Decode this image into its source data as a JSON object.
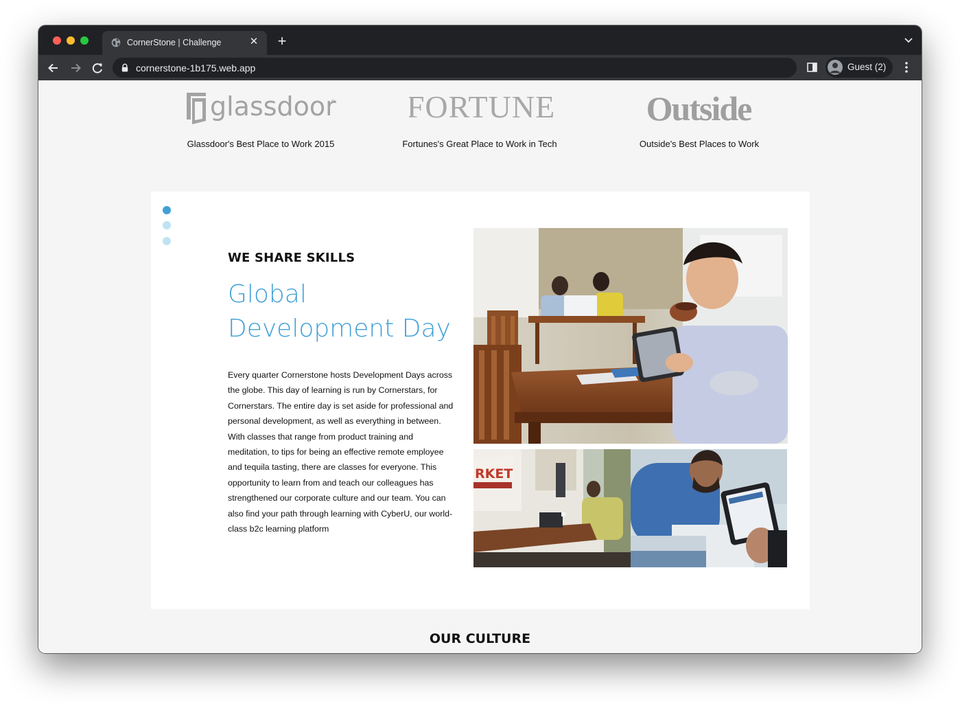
{
  "browser": {
    "tab_title": "CornerStone | Challenge",
    "url": "cornerstone-1b175.web.app",
    "profile_label": "Guest (2)"
  },
  "awards": [
    {
      "logo_text": "glassdoor",
      "caption": "Glassdoor's Best Place to Work 2015"
    },
    {
      "logo_text": "FORTUNE",
      "caption": "Fortunes's Great Place to Work in Tech"
    },
    {
      "logo_text": "Outside",
      "caption": "Outside's Best Places to Work"
    }
  ],
  "feature": {
    "eyebrow": "WE SHARE SKILLS",
    "headline_line1": "Global",
    "headline_line2": "Development Day",
    "body": "Every quarter Cornerstone hosts Development Days across the globe. This day of learning is run by Cornerstars, for Cornerstars. The entire day is set aside for professional and personal development, as well as everything in between. With classes that range from product training and meditation, to tips for being an effective remote employee and tequila tasting, there are classes for everyone. This opportunity to learn from and teach our colleagues has strengthened our corporate culture and our team. You can also find your path through learning with CyberU, our world-class b2c learning platform",
    "photo_sign_text": "RKET",
    "carousel_active_index": 0,
    "carousel_count": 3
  },
  "next_section": {
    "title": "OUR CULTURE"
  },
  "colors": {
    "accent": "#3fa0d6",
    "dot_inactive": "#bfe3f2",
    "page_bg": "#f5f5f5",
    "chrome_dark": "#202124",
    "chrome_tab": "#35363a"
  }
}
